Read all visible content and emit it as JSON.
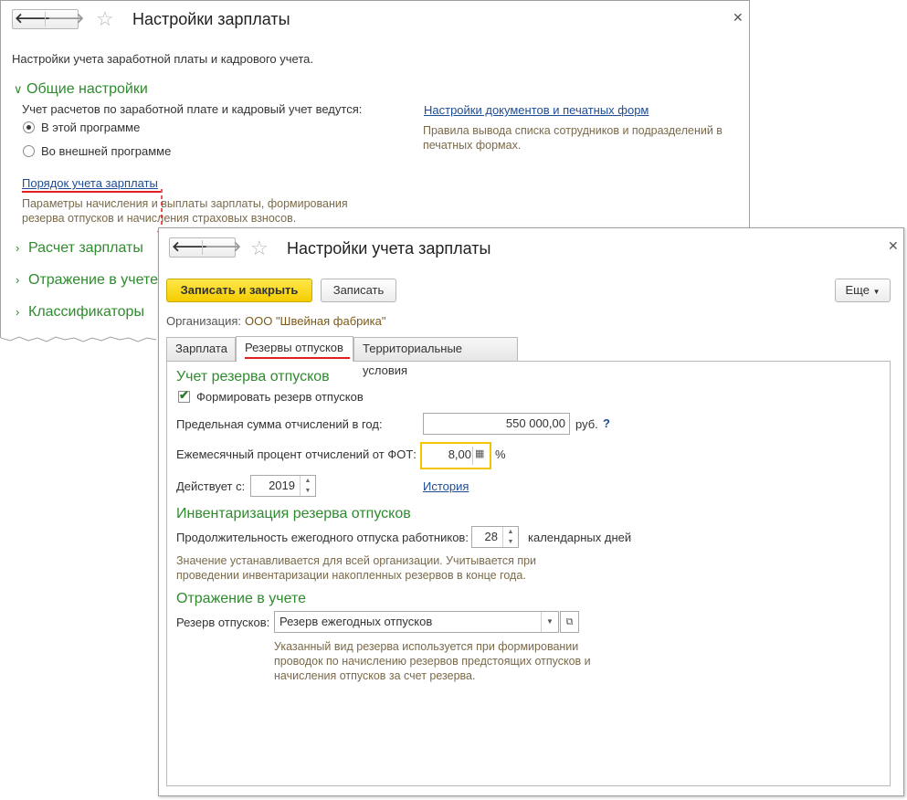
{
  "w1": {
    "title": "Настройки зарплаты",
    "intro": "Настройки учета заработной платы и кадрового учета.",
    "general_section": "Общие настройки",
    "accounting_question": "Учет расчетов по заработной плате и кадровый учет ведутся:",
    "radio_in_program": "В этой программе",
    "radio_external": "Во внешней программе",
    "link_order": "Порядок учета зарплаты",
    "hint_order": "Параметры начисления и выплаты зарплаты, формирования резерва отпусков и начисления страховых взносов.",
    "link_docs": "Настройки документов и печатных форм",
    "hint_docs": "Правила вывода списка сотрудников и подразделений в печатных формах.",
    "section_calc": "Расчет зарплаты",
    "section_reflect": "Отражение в учете",
    "section_classif": "Классификаторы"
  },
  "w2": {
    "title": "Настройки учета зарплаты",
    "btn_save_close": "Записать и закрыть",
    "btn_save": "Записать",
    "btn_more": "Еще",
    "org_label": "Организация:",
    "org_value": "ООО \"Швейная фабрика\"",
    "tabs": [
      "Зарплата",
      "Резервы отпусков",
      "Территориальные условия"
    ],
    "sec1": "Учет резерва отпусков",
    "chk_form": "Формировать резерв отпусков",
    "limit_label": "Предельная сумма отчислений в год:",
    "limit_value": "550 000,00",
    "limit_unit": "руб.",
    "help": "?",
    "monthly_label": "Ежемесячный процент отчислений от ФОТ:",
    "monthly_value": "8,00",
    "monthly_unit": "%",
    "valid_label": "Действует с:",
    "valid_value": "2019",
    "history_link": "История",
    "sec2": "Инвентаризация резерва отпусков",
    "duration_label": "Продолжительность ежегодного отпуска работников:",
    "duration_value": "28",
    "duration_unit": "календарных дней",
    "hint_duration": "Значение устанавливается для всей организации. Учитывается при проведении инвентаризации накопленных резервов в конце года.",
    "sec3": "Отражение в учете",
    "reserve_label": "Резерв отпусков:",
    "reserve_value": "Резерв ежегодных отпусков",
    "hint_reserve": "Указанный вид резерва используется при формировании проводок по начислению резервов предстоящих отпусков и начисления отпусков за счет резерва."
  },
  "colors": {
    "accent_green": "#2e8b2e",
    "link_blue": "#1f4c96",
    "highlight_red": "#e02020",
    "primary_yellow": "#f5cc00"
  },
  "icons": [
    "back-arrow-icon",
    "forward-arrow-icon",
    "star-icon",
    "close-icon",
    "chevron-down-icon",
    "chevron-right-icon",
    "calculator-icon",
    "open-form-icon"
  ]
}
